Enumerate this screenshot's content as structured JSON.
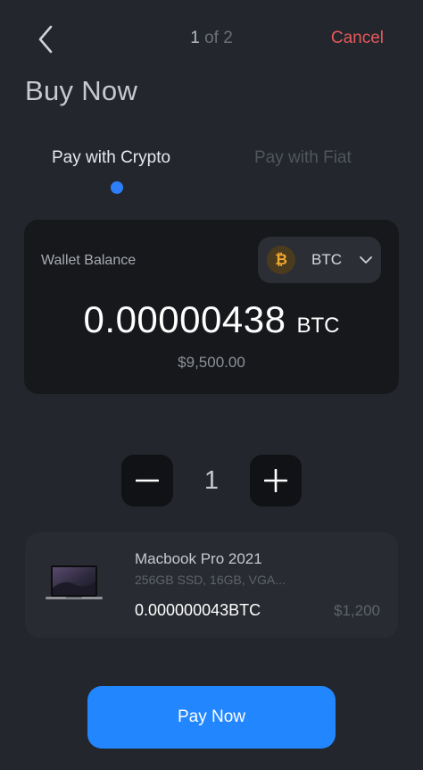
{
  "header": {
    "back_icon": "chevron-left-icon",
    "step_current": "1",
    "step_rest": " of 2",
    "cancel_label": "Cancel"
  },
  "page_title": "Buy Now",
  "tabs": [
    {
      "label": "Pay with Crypto",
      "active": true
    },
    {
      "label": "Pay with Fiat",
      "active": false
    }
  ],
  "wallet": {
    "label": "Wallet Balance",
    "coin_icon": "bitcoin-icon",
    "coin_symbol": "₿",
    "coin": "BTC",
    "balance": "0.00000438",
    "balance_unit": "BTC",
    "fiat_value": "$9,500.00"
  },
  "stepper": {
    "minus_icon": "minus-icon",
    "plus_icon": "plus-icon",
    "quantity": "1"
  },
  "product": {
    "image": "laptop-image",
    "name": "Macbook Pro 2021",
    "specs": "256GB SSD, 16GB, VGA...",
    "crypto_price": "0.000000043BTC",
    "fiat_price": "$1,200"
  },
  "pay_button": {
    "label": "Pay Now"
  },
  "colors": {
    "background": "#23262c",
    "card": "#17181b",
    "accent": "#2287ff",
    "cancel": "#e55a5a",
    "bitcoin": "#f2a72e"
  }
}
